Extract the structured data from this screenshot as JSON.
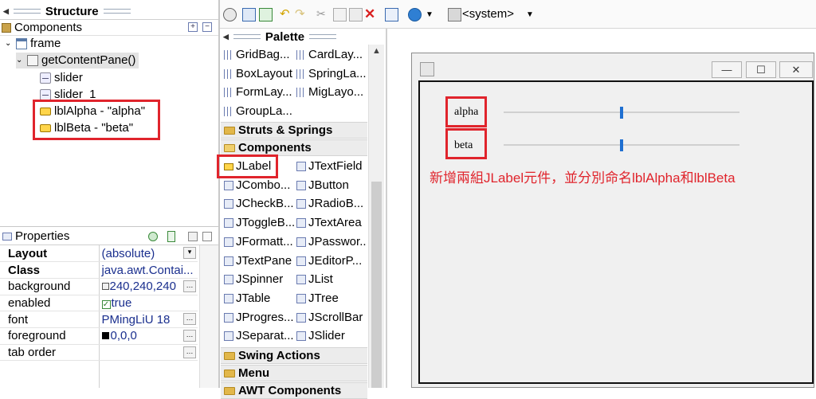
{
  "structure": {
    "title": "Structure",
    "components_label": "Components",
    "tree": [
      {
        "label": "frame"
      },
      {
        "label": "getContentPane()"
      },
      {
        "label": "slider"
      },
      {
        "label": "slider_1"
      },
      {
        "label": "lblAlpha - \"alpha\""
      },
      {
        "label": "lblBeta - \"beta\""
      }
    ]
  },
  "properties": {
    "title": "Properties",
    "rows": [
      {
        "key": "Layout",
        "value": "(absolute)"
      },
      {
        "key": "Class",
        "value": "java.awt.Contai..."
      },
      {
        "key": "background",
        "value": "240,240,240",
        "swatch": "#f0f0f0"
      },
      {
        "key": "enabled",
        "value": "true"
      },
      {
        "key": "font",
        "value": "PMingLiU 18"
      },
      {
        "key": "foreground",
        "value": "0,0,0",
        "swatch": "#000000"
      },
      {
        "key": "tab order",
        "value": ""
      }
    ]
  },
  "toolbar": {
    "system_label": "<system>"
  },
  "palette": {
    "title": "Palette",
    "layouts": [
      [
        "GridBag...",
        "CardLay..."
      ],
      [
        "BoxLayout",
        "SpringLa..."
      ],
      [
        "FormLay...",
        "MigLayo..."
      ],
      [
        "GroupLa..."
      ]
    ],
    "cat_struts": "Struts & Springs",
    "cat_components": "Components",
    "components": [
      [
        "JLabel",
        "JTextField"
      ],
      [
        "JCombo...",
        "JButton"
      ],
      [
        "JCheckB...",
        "JRadioB..."
      ],
      [
        "JToggleB...",
        "JTextArea"
      ],
      [
        "JFormatt...",
        "JPasswor..."
      ],
      [
        "JTextPane",
        "JEditorP..."
      ],
      [
        "JSpinner",
        "JList"
      ],
      [
        "JTable",
        "JTree"
      ],
      [
        "JProgres...",
        "JScrollBar"
      ],
      [
        "JSeparat...",
        "JSlider"
      ]
    ],
    "cat_swing_actions": "Swing Actions",
    "cat_menu": "Menu",
    "cat_awt": "AWT Components"
  },
  "design": {
    "label_alpha": "alpha",
    "label_beta": "beta",
    "slider_alpha_value": 0.5,
    "slider_beta_value": 0.5,
    "annotation": "新增兩組JLabel元件，並分別命名lblAlpha和lblBeta",
    "annotation_color": "#e0242c"
  },
  "colors": {
    "highlight": "#e0242c",
    "value_text": "#1a2f8e",
    "slider_thumb": "#1f6fd1"
  }
}
